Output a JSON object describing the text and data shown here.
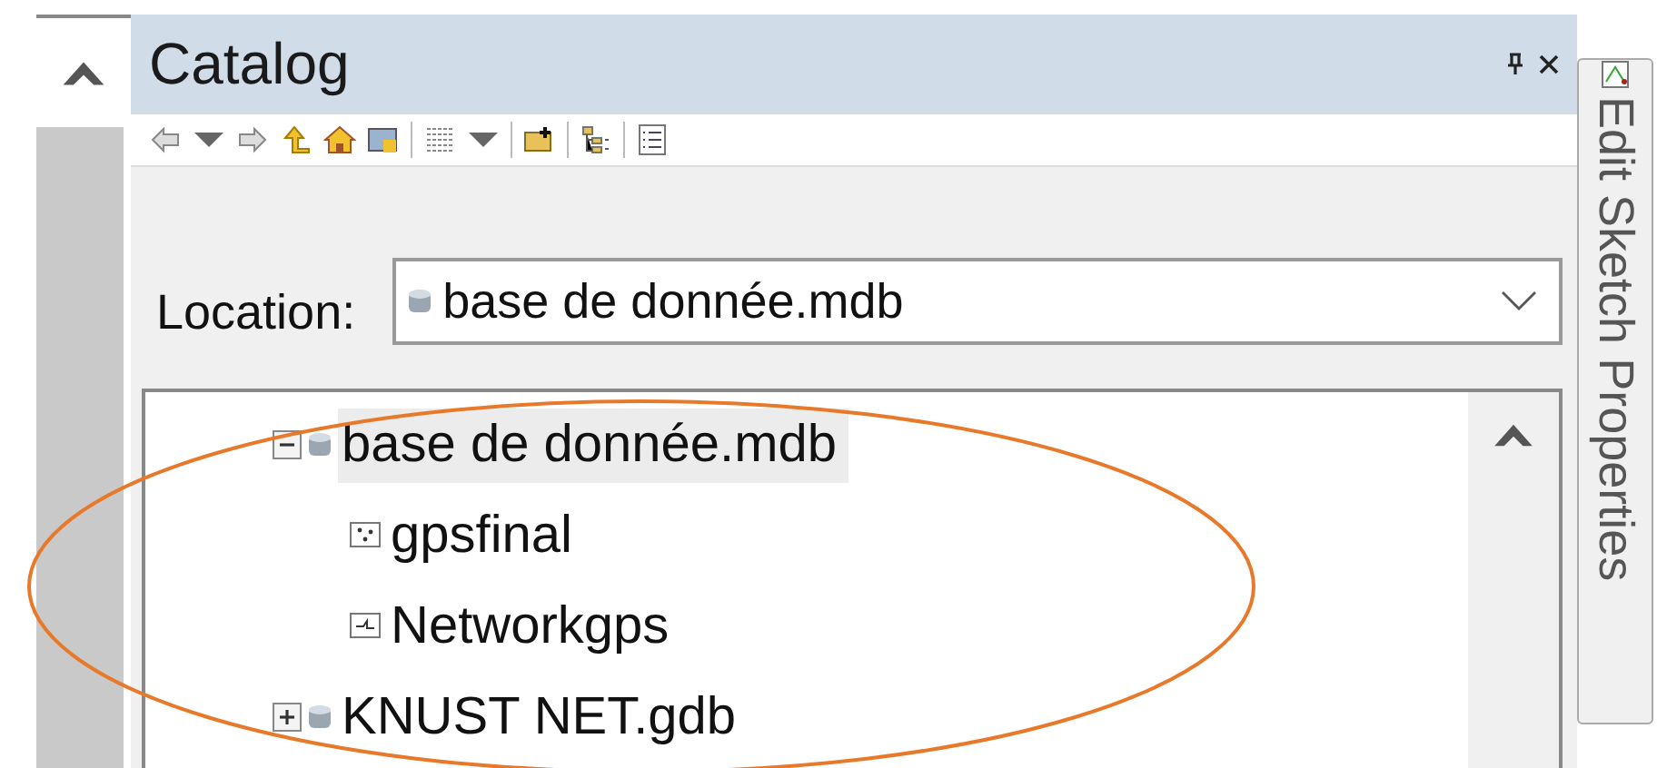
{
  "panel": {
    "title": "Catalog"
  },
  "location": {
    "label": "Location:",
    "value": "base de donnée.mdb"
  },
  "tree": [
    {
      "label": "base de donnée.mdb",
      "kind": "database",
      "expanded": true,
      "selected": true,
      "children": [
        {
          "label": "gpsfinal",
          "kind": "points",
          "selected": false
        },
        {
          "label": "Networkgps",
          "kind": "network",
          "selected": false
        }
      ]
    },
    {
      "label": "KNUST NET.gdb",
      "kind": "database",
      "expanded": false,
      "selected": false
    }
  ],
  "side_tab": {
    "label": "Edit Sketch Properties"
  }
}
